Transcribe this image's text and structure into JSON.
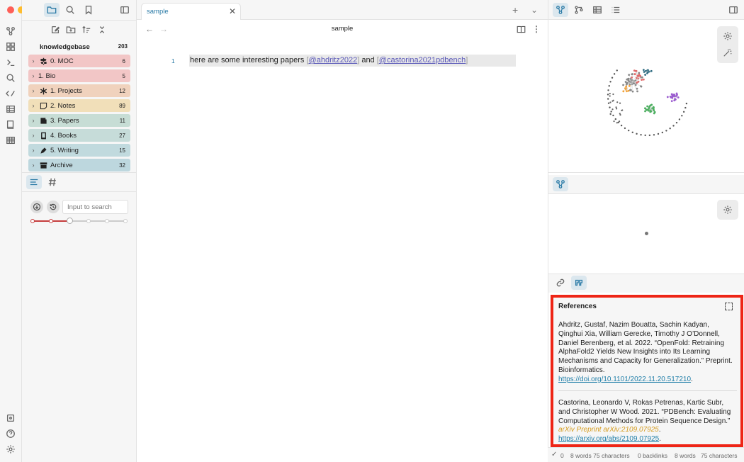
{
  "colors": {
    "accent": "#2a7aa6",
    "highlight_border": "#ee2516",
    "citation": "#5a58b8",
    "link": "#1f7ea8",
    "journal": "#d49b1d",
    "traffic_red": "#fe5f57",
    "traffic_yellow": "#febc2e",
    "traffic_green": "#28c840"
  },
  "sidebar": {
    "vault_name": "knowledgebase",
    "vault_count": "203",
    "search_placeholder": "Input to search",
    "folders": [
      {
        "label": "0. MOC",
        "count": "6",
        "color": "#f2c6c6",
        "icon": "signpost-icon"
      },
      {
        "label": "1. Bio",
        "count": "5",
        "color": "#f2c6c6",
        "icon": ""
      },
      {
        "label": "1. Projects",
        "count": "12",
        "color": "#f0d2bd",
        "icon": "snowflake-icon"
      },
      {
        "label": "2. Notes",
        "count": "89",
        "color": "#f1dfb9",
        "icon": "sticky-note-icon"
      },
      {
        "label": "3. Papers",
        "count": "11",
        "color": "#c7ddd5",
        "icon": "newspaper-icon"
      },
      {
        "label": "4. Books",
        "count": "27",
        "color": "#c6dcd9",
        "icon": "book-icon"
      },
      {
        "label": "5. Writing",
        "count": "15",
        "color": "#c1dade",
        "icon": "pen-icon"
      },
      {
        "label": "Archive",
        "count": "32",
        "color": "#bdd7de",
        "icon": "archive-icon"
      }
    ]
  },
  "editor": {
    "tab_title": "sample",
    "note_title": "sample",
    "line_number": "1",
    "text_prefix": "here are some interesting papers ",
    "cite1": "@ahdritz2022",
    "text_mid": " and ",
    "cite2": "@castorina2021pdbench"
  },
  "references": {
    "heading": "References",
    "items": [
      {
        "text": "Ahdritz, Gustaf, Nazim Bouatta, Sachin Kadyan, Qinghui Xia, William Gerecke, Timothy J O’Donnell, Daniel Berenberg, et al. 2022. “OpenFold: Retraining AlphaFold2 Yields New Insights into Its Learning Mechanisms and Capacity for Generalization.” Preprint. Bioinformatics. ",
        "journal": "",
        "link": "https://doi.org/10.1101/2022.11.20.517210"
      },
      {
        "text": "Castorina, Leonardo V, Rokas Petrenas, Kartic Subr, and Christopher W Wood. 2021. “PDBench: Evaluating Computational Methods for Protein Sequence Design.” ",
        "journal": "arXiv Preprint arXiv:2109.07925",
        "link": "https://arxiv.org/abs/2109.07925"
      }
    ]
  },
  "status": {
    "check_count": "0",
    "words1": "8 words 75 characters",
    "backlinks": "0 backlinks",
    "words2": "8 words",
    "chars2": "75 characters"
  }
}
